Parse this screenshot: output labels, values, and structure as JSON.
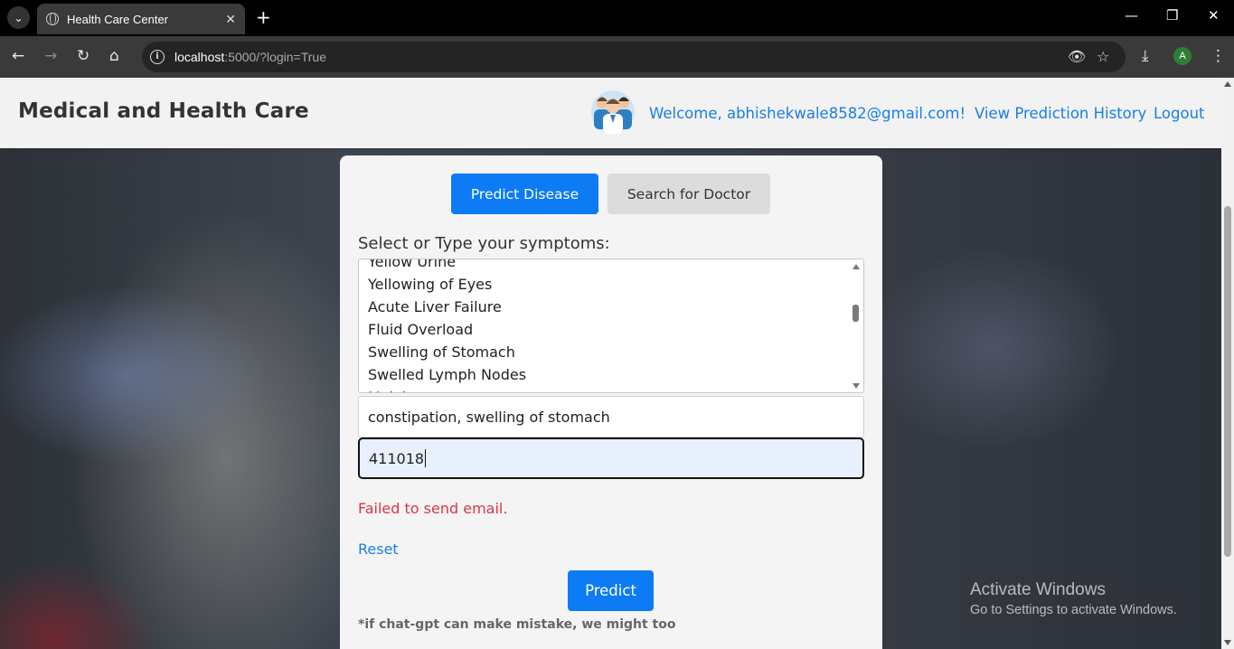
{
  "browser": {
    "tab_title": "Health Care Center",
    "tab_list_icon": "chevron-down-icon",
    "newtab_label": "+",
    "url_host": "localhost",
    "url_rest": ":5000/?login=True",
    "profile_initial": "A"
  },
  "header": {
    "brand": "Medical and Health Care",
    "welcome": "Welcome, abhishekwale8582@gmail.com!",
    "history_link": "View Prediction History",
    "logout_link": "Logout"
  },
  "tabs": {
    "predict_label": "Predict Disease",
    "doctor_label": "Search for Doctor"
  },
  "form": {
    "symptoms_label": "Select or Type your symptoms:",
    "options": [
      "Yellow Urine",
      "Yellowing of Eyes",
      "Acute Liver Failure",
      "Fluid Overload",
      "Swelling of Stomach",
      "Swelled Lymph Nodes",
      "Malaise"
    ],
    "symptoms_value": "constipation, swelling of stomach",
    "pincode_value": "411018",
    "error_message": "Failed to send email.",
    "reset_label": "Reset",
    "predict_label": "Predict",
    "disclaimer": "*if chat-gpt can make mistake, we might too"
  },
  "watermark": {
    "title": "Activate Windows",
    "subtitle": "Go to Settings to activate Windows."
  },
  "colors": {
    "primary": "#0d7bf3",
    "link": "#1a7ee6",
    "error": "#dc3545"
  }
}
